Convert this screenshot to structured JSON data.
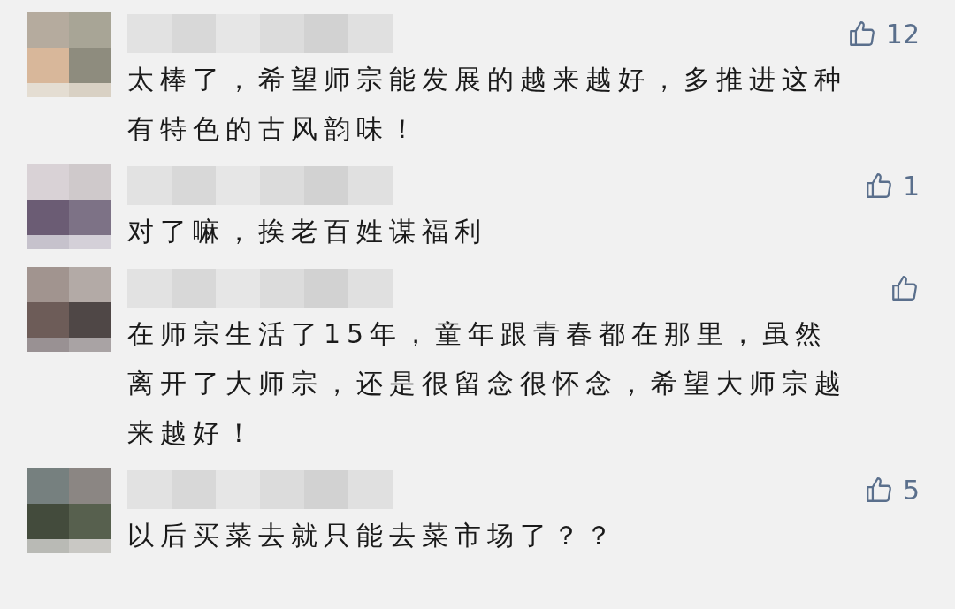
{
  "comments": [
    {
      "likes": "12",
      "lines": [
        "太棒了，希望师宗能发展的越来越好，多推进这种",
        "有特色的古风韵味！"
      ]
    },
    {
      "likes": "1",
      "lines": [
        "对了嘛，挨老百姓谋福利"
      ]
    },
    {
      "lines": [
        "在师宗生活了15年，童年跟青春都在那里，虽然",
        "离开了大师宗，还是很留念很怀念，希望大师宗越",
        "来越好！"
      ]
    },
    {
      "likes": "5",
      "lines": [
        "以后买菜去就只能去菜市场了？？"
      ]
    }
  ]
}
